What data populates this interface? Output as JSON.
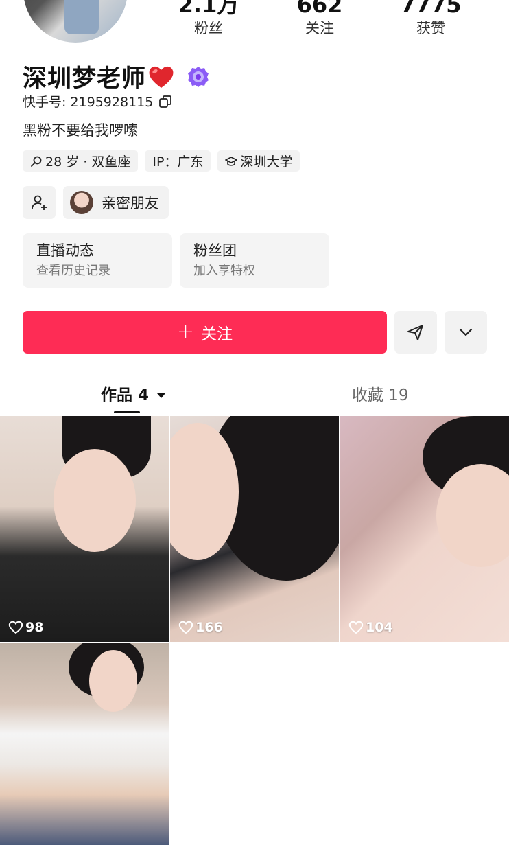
{
  "stats": [
    {
      "value": "2.1万",
      "label": "粉丝"
    },
    {
      "value": "662",
      "label": "关注"
    },
    {
      "value": "7775",
      "label": "获赞"
    }
  ],
  "profile": {
    "name": "深圳梦老师",
    "uid": "快手号: 2195928115",
    "bio": "黑粉不要给我啰嗦",
    "tags": [
      "28 岁 · 双鱼座",
      "IP：广东",
      "深圳大学"
    ]
  },
  "friends": {
    "close_label": "亲密朋友"
  },
  "cards": [
    {
      "title": "直播动态",
      "subtitle": "查看历史记录"
    },
    {
      "title": "粉丝团",
      "subtitle": "加入享特权"
    }
  ],
  "actions": {
    "follow_label": "关注"
  },
  "tabs": {
    "works": "作品 4",
    "favorites": "收藏 19"
  },
  "posts": [
    {
      "likes": "98"
    },
    {
      "likes": "166"
    },
    {
      "likes": "104"
    }
  ],
  "colors": {
    "accent": "#fe2c55",
    "heart": "#e0262d",
    "badge": "#8b5cf6"
  }
}
